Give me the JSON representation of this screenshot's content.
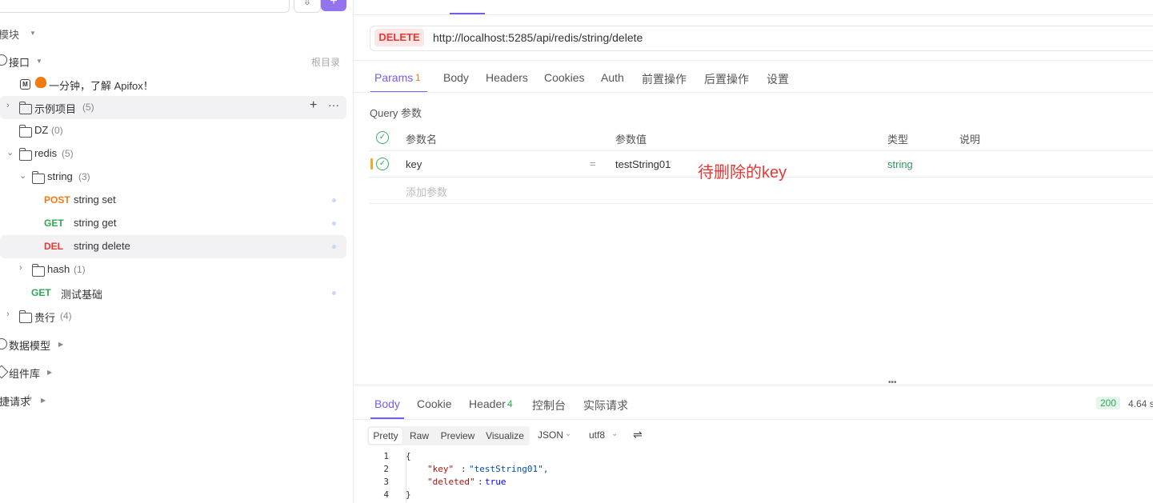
{
  "sidebar": {
    "modules_label": "模块",
    "api_label": "接口",
    "root_dir": "根目录",
    "items": [
      {
        "label": "一分钟，了解 Apifox！"
      },
      {
        "label": "示例项目",
        "count": "(5)"
      },
      {
        "label": "DZ",
        "count": "(0)"
      },
      {
        "label": "redis",
        "count": "(5)"
      },
      {
        "label": "string",
        "count": "(3)"
      },
      {
        "method": "POST",
        "label": "string set"
      },
      {
        "method": "GET",
        "label": "string get"
      },
      {
        "method": "DEL",
        "label": "string delete"
      },
      {
        "label": "hash",
        "count": "(1)"
      },
      {
        "method": "GET",
        "label": "测试基础"
      },
      {
        "label": "贵行",
        "count": "(4)"
      }
    ],
    "data_models": "数据模型",
    "components": "组件库",
    "quick_requests": "捷请求"
  },
  "request": {
    "method": "DELETE",
    "url": "http://localhost:5285/api/redis/string/delete"
  },
  "tabs": [
    {
      "label": "Params",
      "badge": "1"
    },
    {
      "label": "Body"
    },
    {
      "label": "Headers"
    },
    {
      "label": "Cookies"
    },
    {
      "label": "Auth"
    },
    {
      "label": "前置操作"
    },
    {
      "label": "后置操作"
    },
    {
      "label": "设置"
    }
  ],
  "query": {
    "title": "Query 参数",
    "headers": {
      "name": "参数名",
      "value": "参数值",
      "type": "类型",
      "desc": "说明"
    },
    "rows": [
      {
        "name": "key",
        "eq": "=",
        "value": "testString01",
        "type": "string"
      }
    ],
    "add_placeholder": "添加参数",
    "annotation": "待删除的key"
  },
  "response": {
    "tabs": [
      {
        "label": "Body"
      },
      {
        "label": "Cookie"
      },
      {
        "label": "Header",
        "badge": "4"
      },
      {
        "label": "控制台"
      },
      {
        "label": "实际请求"
      }
    ],
    "status": "200",
    "time": "4.64 s",
    "view_modes": [
      "Pretty",
      "Raw",
      "Preview",
      "Visualize"
    ],
    "format": "JSON",
    "encoding": "utf8",
    "lines": [
      {
        "n": "1",
        "text": "{"
      },
      {
        "n": "2",
        "key": "\"key\"",
        "val": "\"testString01\","
      },
      {
        "n": "3",
        "key": "\"deleted\"",
        "val": "true"
      },
      {
        "n": "4",
        "text": "}"
      }
    ]
  },
  "colors": {
    "accent": "#7a5ce6",
    "delete": "#e53935",
    "post": "#f07b13",
    "get": "#2fa855",
    "string_type": "#2e9b5a"
  }
}
